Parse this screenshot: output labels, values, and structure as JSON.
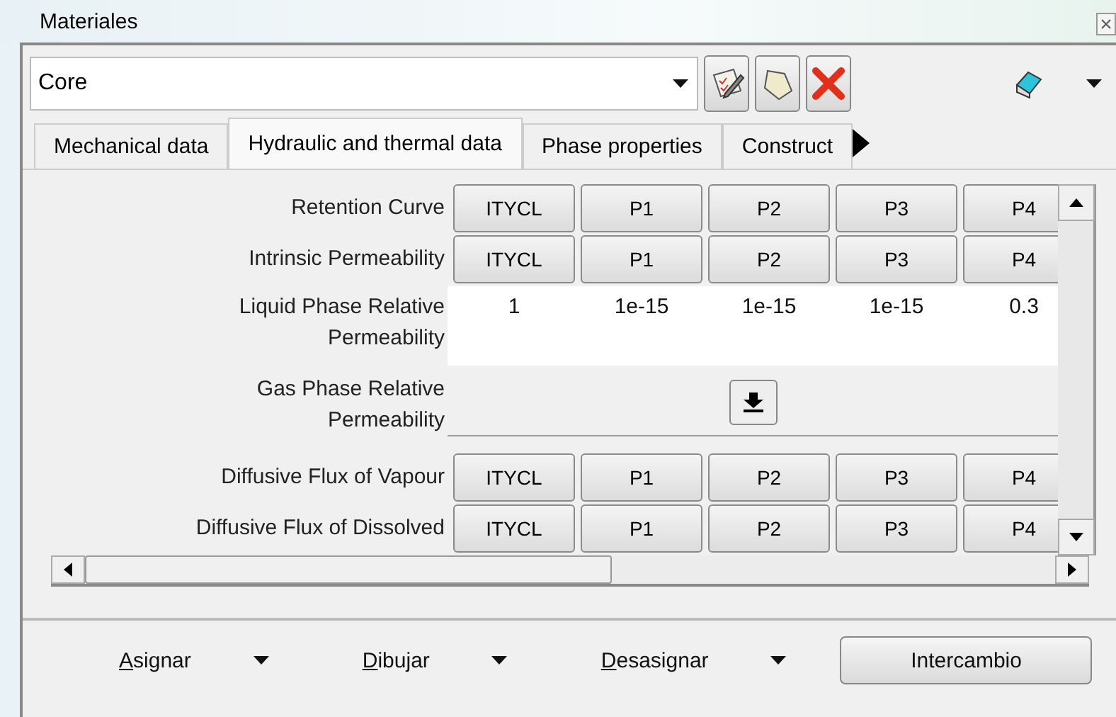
{
  "window": {
    "title": "Materiales"
  },
  "material_select": {
    "value": "Core"
  },
  "tabs": [
    {
      "label": "Mechanical data",
      "selected": false
    },
    {
      "label": "Hydraulic and thermal data",
      "selected": true
    },
    {
      "label": "Phase properties",
      "selected": false
    },
    {
      "label": "Construct",
      "selected": false
    }
  ],
  "rows": [
    {
      "kind": "buttons",
      "label": "Retention Curve",
      "cells": [
        "ITYCL",
        "P1",
        "P2",
        "P3",
        "P4"
      ]
    },
    {
      "kind": "buttons",
      "label": "Intrinsic Permeability",
      "cells": [
        "ITYCL",
        "P1",
        "P2",
        "P3",
        "P4"
      ]
    },
    {
      "kind": "values",
      "label": "Liquid Phase Relative Permeability",
      "cells": [
        "1",
        "1e-15",
        "1e-15",
        "1e-15",
        "0.3"
      ]
    },
    {
      "kind": "collapsed",
      "label": "Gas Phase Relative Permeability"
    },
    {
      "kind": "buttons",
      "label": "Diffusive Flux of Vapour",
      "cells": [
        "ITYCL",
        "P1",
        "P2",
        "P3",
        "P4"
      ]
    },
    {
      "kind": "buttons",
      "label": "Diffusive Flux of Dissolved",
      "cells": [
        "ITYCL",
        "P1",
        "P2",
        "P3",
        "P4"
      ]
    }
  ],
  "actions": [
    {
      "kind": "menu",
      "label": "Asignar",
      "mnemonic": true
    },
    {
      "kind": "menu",
      "label": "Dibujar",
      "mnemonic": true
    },
    {
      "kind": "menu",
      "label": "Desasignar",
      "mnemonic": true
    },
    {
      "kind": "button",
      "label": "Intercambio",
      "mnemonic": false
    }
  ]
}
